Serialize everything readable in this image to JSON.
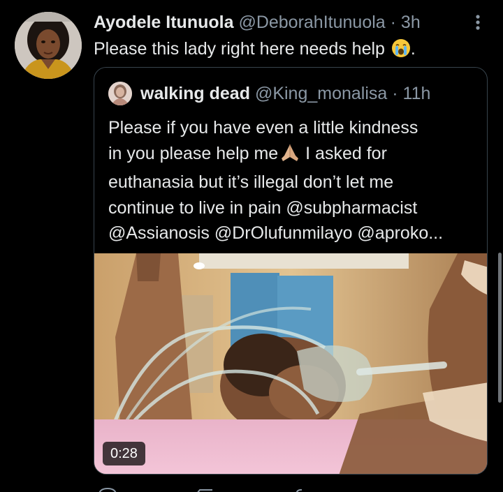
{
  "tweet": {
    "author_name": "Ayodele Itunuola",
    "author_handle": "@DeborahItunuola",
    "separator": "·",
    "time": "3h",
    "text": "Please this lady right here needs help",
    "text_end": ".",
    "text_emoji": "crying-face-emoji"
  },
  "quoted_tweet": {
    "author_name": "walking dead",
    "author_handle": "@King_monalisa",
    "separator": "·",
    "time": "11h",
    "lines": [
      "Please if you have even a little kindness",
      "in you please help me",
      "euthanasia but it’s illegal don’t let me",
      "continue to live in pain @subpharmacist",
      "@Assianosis @DrOlufunmilayo @aproko..."
    ],
    "line2_suffix": " I asked for",
    "line2_emoji": "folded-hands-emoji",
    "media": {
      "type": "video",
      "duration": "0:28",
      "description_icon": "video-thumbnail"
    }
  },
  "colors": {
    "background": "#000000",
    "primary_text": "#e7e9ea",
    "secondary_text": "#8b98a5",
    "border": "#38444d"
  },
  "icons": [
    "more-options-icon",
    "crying-face-emoji",
    "folded-hands-emoji"
  ]
}
